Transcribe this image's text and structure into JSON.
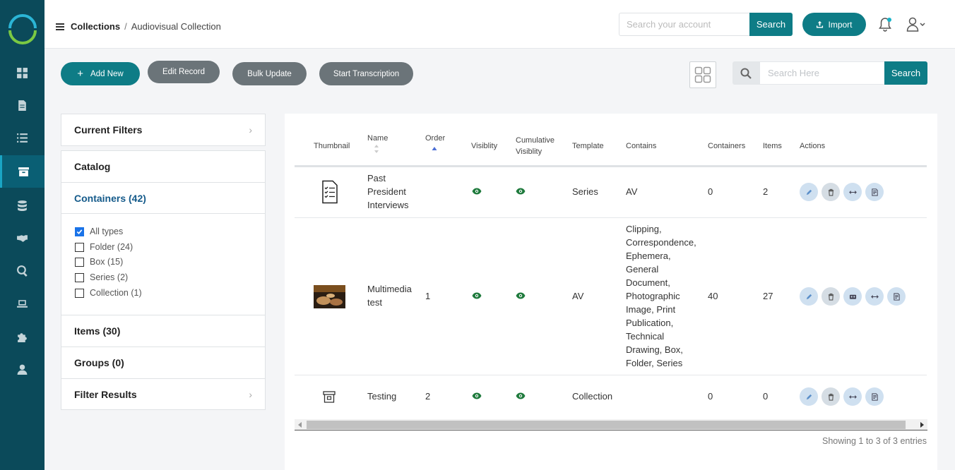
{
  "nav": {
    "items": [
      {
        "name": "dashboard",
        "icon": "dashboard-icon"
      },
      {
        "name": "documents",
        "icon": "document-icon"
      },
      {
        "name": "list",
        "icon": "list-icon"
      },
      {
        "name": "collections",
        "icon": "archive-box-icon",
        "active": true
      },
      {
        "name": "database",
        "icon": "database-icon"
      },
      {
        "name": "partners",
        "icon": "handshake-icon"
      },
      {
        "name": "search",
        "icon": "zoom-search-icon"
      },
      {
        "name": "computer",
        "icon": "laptop-icon"
      },
      {
        "name": "plugins",
        "icon": "puzzle-icon"
      },
      {
        "name": "users",
        "icon": "user-icon"
      }
    ]
  },
  "header": {
    "breadcrumb_root": "Collections",
    "breadcrumb_separator": "/",
    "breadcrumb_current": "Audiovisual Collection",
    "search_placeholder": "Search your account",
    "search_button": "Search",
    "import_button": "Import"
  },
  "toolbar": {
    "add_new": "Add New",
    "edit_record": "Edit Record",
    "bulk_update": "Bulk Update",
    "start_transcription": "Start Transcription",
    "search_placeholder": "Search Here",
    "search_button": "Search"
  },
  "filters": {
    "current_filters": "Current Filters",
    "catalog": "Catalog",
    "containers": "Containers (42)",
    "types": [
      {
        "label": "All types",
        "checked": true
      },
      {
        "label": "Folder (24)",
        "checked": false
      },
      {
        "label": "Box (15)",
        "checked": false
      },
      {
        "label": "Series (2)",
        "checked": false
      },
      {
        "label": "Collection (1)",
        "checked": false
      }
    ],
    "items": "Items (30)",
    "groups": "Groups (0)",
    "filter_results": "Filter Results"
  },
  "table": {
    "headers": {
      "thumbnail": "Thumbnail",
      "name": "Name",
      "order": "Order",
      "visibility": "Visiblity",
      "cumulative_visibility_1": "Cumulative",
      "cumulative_visibility_2": "Visiblity",
      "template": "Template",
      "contains": "Contains",
      "containers": "Containers",
      "items": "Items",
      "actions": "Actions"
    },
    "rows": [
      {
        "thumbnail": "checklist-document-icon",
        "name_lines": [
          "Past",
          "President",
          "Interviews"
        ],
        "order": "",
        "template": "Series",
        "contains_lines": [
          "AV"
        ],
        "containers": "0",
        "items": "2"
      },
      {
        "thumbnail": "photo-thumbnail",
        "name_lines": [
          "Multimedia",
          "test"
        ],
        "order": "1",
        "template": "AV",
        "contains_lines": [
          "Clipping,",
          "Correspondence,",
          "Ephemera,",
          "General",
          "Document,",
          "Photographic",
          "Image, Print",
          "Publication,",
          "Technical",
          "Drawing, Box,",
          "Folder, Series"
        ],
        "containers": "40",
        "items": "27"
      },
      {
        "thumbnail": "archive-box-icon",
        "name_lines": [
          "Testing"
        ],
        "order": "2",
        "template": "Collection",
        "contains_lines": [],
        "containers": "0",
        "items": "0"
      }
    ],
    "footer": "Showing 1 to 3 of 3 entries"
  },
  "colors": {
    "sidebar": "#0b4a5a",
    "accent": "#0e7c86",
    "gray_button": "#6b7479",
    "eye_green": "#1e7a3c",
    "link_blue": "#145a8a"
  }
}
